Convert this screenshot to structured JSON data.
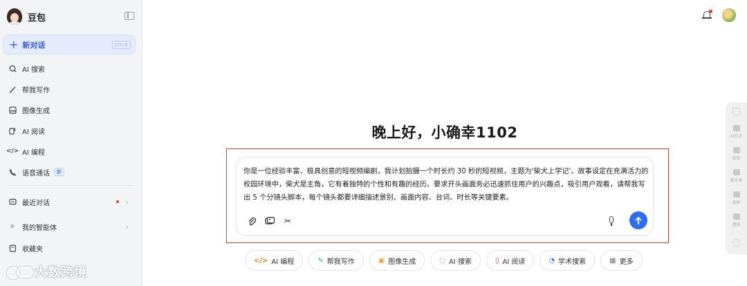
{
  "sidebar": {
    "brand_name": "豆包",
    "new_chat": {
      "label": "新对话",
      "shortcut": "Ctrl K"
    },
    "items": [
      {
        "label": "AI 搜索",
        "icon": "search-icon"
      },
      {
        "label": "帮我写作",
        "icon": "pen-icon"
      },
      {
        "label": "图像生成",
        "icon": "image-icon"
      },
      {
        "label": "AI 阅读",
        "icon": "read-icon"
      },
      {
        "label": "AI 编程",
        "icon": "code-icon"
      },
      {
        "label": "语音通话",
        "icon": "phone-icon",
        "badge": "新"
      }
    ],
    "recent": {
      "label": "最近对话"
    },
    "agents": {
      "label": "我的智能体"
    },
    "favorites": {
      "label": "收藏夹"
    }
  },
  "watermark": {
    "text": "大数跨境"
  },
  "greeting": "晚上好，小确幸1102",
  "input": {
    "text": "你是一位经验丰富、极具创意的短视频编剧，我计划拍摄一个时长约 30 秒的短视频，主题为'柴犬上学记'。故事设定在充满活力的校园环境中，柴犬是主角，它有着独特的个性和有趣的经历。要求开头画面务必迅速抓住用户的兴趣点，吸引用户观看，请帮我写出 5 个分镜头脚本，每个镜头都要详细描述景别、画面内容、台词、时长等关键要素。"
  },
  "chips": [
    {
      "label": "AI 编程",
      "icon": "</>",
      "color": "#e07b1a"
    },
    {
      "label": "帮我写作",
      "icon": "✎",
      "color": "#2fb36b"
    },
    {
      "label": "图像生成",
      "icon": "▣",
      "color": "#f0a030"
    },
    {
      "label": "AI 搜索",
      "icon": "◌",
      "color": "#2e6cf2"
    },
    {
      "label": "AI 阅读",
      "icon": "▯",
      "color": "#e0463f"
    },
    {
      "label": "学术搜索",
      "icon": "◔",
      "color": "#2e6cf2"
    },
    {
      "label": "更多",
      "icon": "▦",
      "color": "#777777"
    }
  ],
  "float_bar": [
    {
      "label": "AI助手"
    },
    {
      "label": "截图"
    },
    {
      "label": "截全屏"
    },
    {
      "label": "录屏"
    },
    {
      "label": "搜索"
    }
  ]
}
